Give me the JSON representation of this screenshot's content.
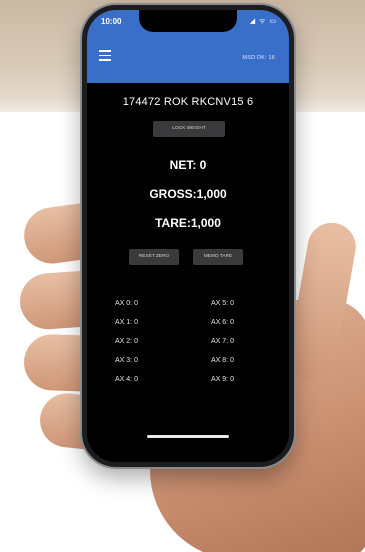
{
  "status": {
    "time": "10:00",
    "icons": "◢ ᯤ ▭"
  },
  "appbar": {
    "right_text": "MSD DK: 16"
  },
  "device": {
    "title": "174472 ROK RKCNV15 6"
  },
  "buttons": {
    "lock": "LOCK WEIGHT",
    "reset": "RESET ZERO",
    "memo": "MEMO TARE"
  },
  "readings": {
    "net": "NET: 0",
    "gross": "GROSS:1,000",
    "tare": "TARE:1,000"
  },
  "axles_left": [
    "AX 0: 0",
    "AX 1: 0",
    "AX 2: 0",
    "AX 3: 0",
    "AX 4: 0"
  ],
  "axles_right": [
    "AX 5: 0",
    "AX 6: 0",
    "AX 7: 0",
    "AX 8: 0",
    "AX 9: 0"
  ],
  "colors": {
    "appbar": "#3a6fc9",
    "screen": "#000000",
    "button": "#3a3a3c"
  }
}
